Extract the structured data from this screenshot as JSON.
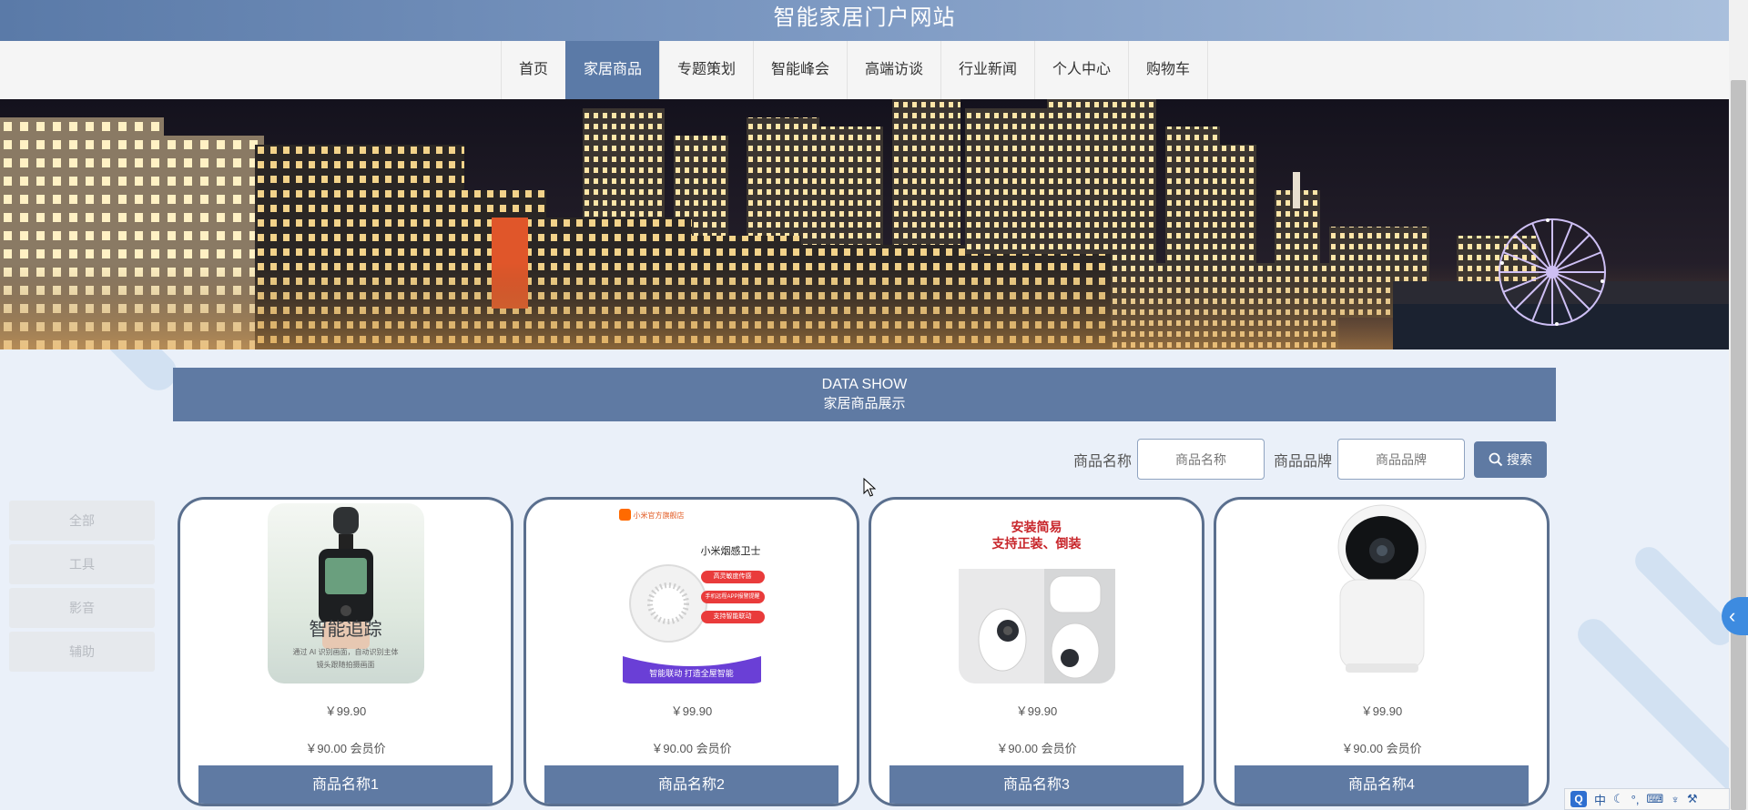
{
  "header": {
    "title": "智能家居门户网站"
  },
  "nav": {
    "items": [
      {
        "label": "首页",
        "active": false
      },
      {
        "label": "家居商品",
        "active": true
      },
      {
        "label": "专题策划",
        "active": false
      },
      {
        "label": "智能峰会",
        "active": false
      },
      {
        "label": "高端访谈",
        "active": false
      },
      {
        "label": "行业新闻",
        "active": false
      },
      {
        "label": "个人中心",
        "active": false
      },
      {
        "label": "购物车",
        "active": false
      }
    ]
  },
  "section": {
    "title_en": "DATA SHOW",
    "title_cn": "家居商品展示"
  },
  "search": {
    "name_label": "商品名称",
    "name_placeholder": "商品名称",
    "brand_label": "商品品牌",
    "brand_placeholder": "商品品牌",
    "button_label": "搜索"
  },
  "categories": [
    "全部",
    "工具",
    "影音",
    "辅助"
  ],
  "products": [
    {
      "name": "商品名称1",
      "price": "￥99.90",
      "member_price": "￥90.00 会员价",
      "image_text": [
        "智能追踪",
        "通过 AI 识别画面，自动识别主体",
        "镜头跟随拍摄画面"
      ]
    },
    {
      "name": "商品名称2",
      "price": "￥99.90",
      "member_price": "￥90.00 会员价",
      "image_text": [
        "小米官方旗舰店",
        "小米烟感卫士",
        "高灵敏度传感",
        "手机远程APP报警提醒",
        "支持智能联动",
        "智能联动 打造全屋智能"
      ]
    },
    {
      "name": "商品名称3",
      "price": "￥99.90",
      "member_price": "￥90.00 会员价",
      "image_text": [
        "安装简易",
        "支持正装、倒装"
      ]
    },
    {
      "name": "商品名称4",
      "price": "￥99.90",
      "member_price": "￥90.00 会员价",
      "image_text": []
    }
  ],
  "ime": {
    "logo": "Q",
    "mode": "中",
    "items": [
      "moon-icon",
      "punct-icon",
      "keyboard-icon",
      "skin-icon",
      "wrench-icon"
    ]
  },
  "colors": {
    "primary": "#5f7aa3",
    "nav_active": "#5b7aa7",
    "page_bg": "#eaf0f9",
    "card_border": "#5a6f8e"
  }
}
